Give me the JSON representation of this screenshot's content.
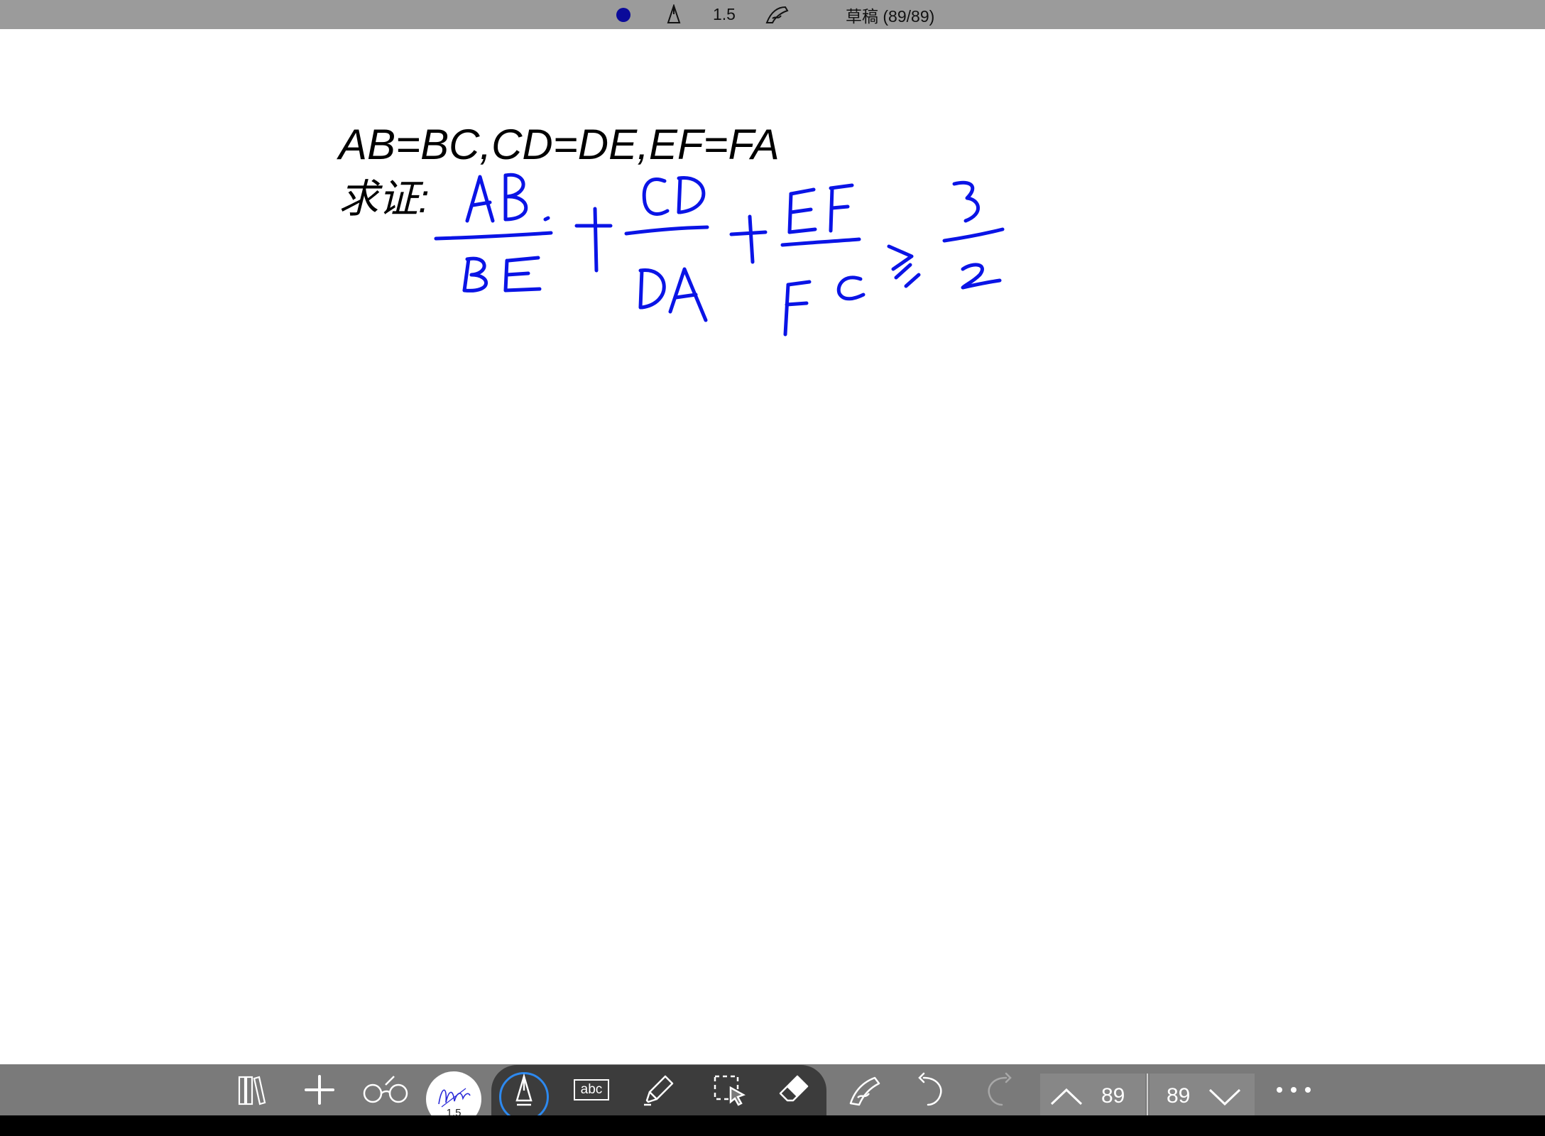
{
  "top_bar": {
    "pen_color": "#0a0a9a",
    "pen_icon": "pen-nib-icon",
    "pen_size": "1.5",
    "handwriting_icon": "hand-pen-icon",
    "doc_title": "草稿 (89/89)"
  },
  "canvas": {
    "typed_line1": "AB=BC,CD=DE,EF=FA",
    "typed_line2": "求证:",
    "ink_color": "#0a14e6"
  },
  "toolbar": {
    "library_icon": "library-icon",
    "add_icon": "plus-icon",
    "view_icon": "glasses-icon",
    "pen_preview_size": "1.5",
    "pen_tool_icon": "pen-nib-icon",
    "text_tool_label": "abc",
    "highlighter_icon": "highlighter-icon",
    "select_icon": "lasso-select-icon",
    "eraser_icon": "eraser-icon",
    "handwriting_icon": "hand-pen-icon",
    "undo_icon": "undo-icon",
    "redo_icon": "redo-icon",
    "current_page": "89",
    "total_page": "89",
    "more_icon": "more-icon"
  }
}
